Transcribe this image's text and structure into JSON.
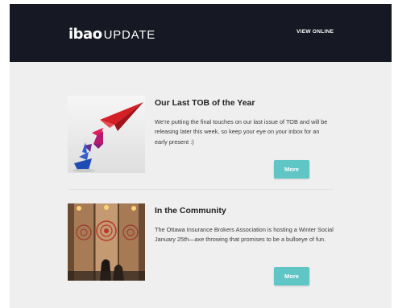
{
  "header": {
    "brand": "ibao",
    "word": "UPDATE",
    "view_online": "VIEW ONLINE",
    "background": "#161923"
  },
  "articles": [
    {
      "title": "Our Last TOB of the Year",
      "body": "We're putting the final touches on our last issue of TOB and will be releasing later this week, so keep your eye on your inbox for an early present :)",
      "button": "More"
    },
    {
      "title": "In the Community",
      "body": "The Ottawa Insurance Brokers Association is hosting a Winter Social January 25th—axe throwing that promises to be a bullseye of fun.",
      "button": "More"
    }
  ],
  "colors": {
    "accent": "#5fc5c5",
    "page_background": "#efefef"
  },
  "icons": [
    "origami-paper-plane-image",
    "axe-throwing-target-image"
  ]
}
